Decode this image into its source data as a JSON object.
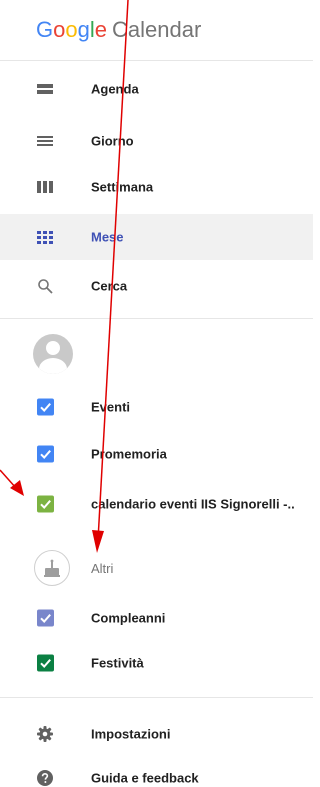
{
  "header": {
    "logo_letters": [
      "G",
      "o",
      "o",
      "g",
      "l",
      "e"
    ],
    "logo_suffix": "Calendar"
  },
  "views": [
    {
      "label": "Agenda",
      "icon": "agenda-icon"
    },
    {
      "label": "Giorno",
      "icon": "day-icon"
    },
    {
      "label": "Settimana",
      "icon": "week-icon"
    },
    {
      "label": "Mese",
      "icon": "month-icon",
      "active": true
    },
    {
      "label": "Cerca",
      "icon": "search-icon"
    }
  ],
  "account": {
    "name": ""
  },
  "calendars": [
    {
      "label": "Eventi",
      "color": "#4285f4",
      "checked": true
    },
    {
      "label": "Promemoria",
      "color": "#4285f4",
      "checked": true
    },
    {
      "label": "calendario eventi IIS Signorelli -..",
      "color": "#7cb342",
      "checked": true
    }
  ],
  "others": {
    "label": "Altri",
    "items": [
      {
        "label": "Compleanni",
        "color": "#7986cb",
        "checked": true
      },
      {
        "label": "Festività",
        "color": "#0b8043",
        "checked": true
      }
    ]
  },
  "footer": [
    {
      "label": "Impostazioni",
      "icon": "gear-icon"
    },
    {
      "label": "Guida e feedback",
      "icon": "help-icon"
    }
  ],
  "colors": {
    "accent": "#3f51b5",
    "annotation_arrow": "#e00000"
  }
}
